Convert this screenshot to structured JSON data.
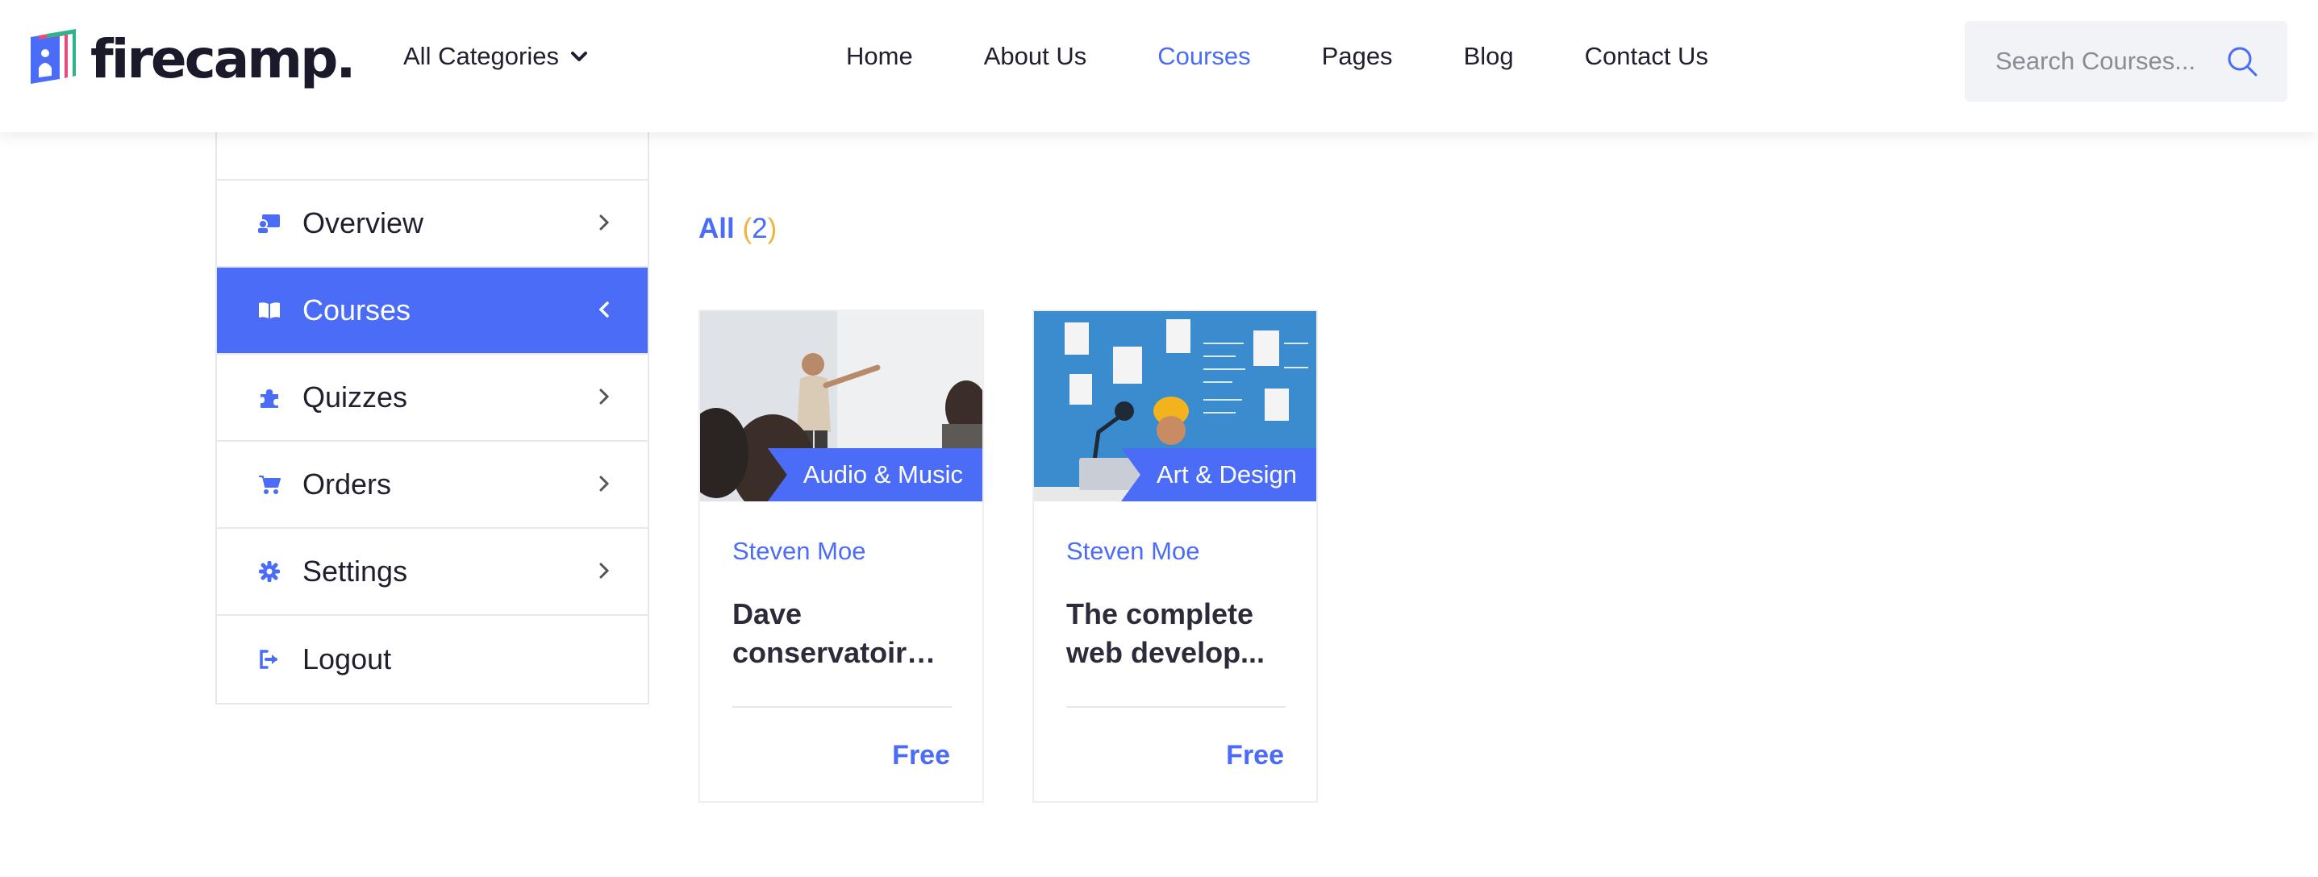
{
  "brand": {
    "name": "firecamp.",
    "accent": "#4a6cf7"
  },
  "header": {
    "categories_label": "All Categories",
    "nav": [
      {
        "label": "Home",
        "active": false
      },
      {
        "label": "About Us",
        "active": false
      },
      {
        "label": "Courses",
        "active": true
      },
      {
        "label": "Pages",
        "active": false
      },
      {
        "label": "Blog",
        "active": false
      },
      {
        "label": "Contact Us",
        "active": false
      }
    ],
    "search_placeholder": "Search Courses..."
  },
  "sidebar": {
    "items": [
      {
        "label": "Overview",
        "icon": "overview-icon",
        "active": false
      },
      {
        "label": "Courses",
        "icon": "book-icon",
        "active": true
      },
      {
        "label": "Quizzes",
        "icon": "puzzle-icon",
        "active": false
      },
      {
        "label": "Orders",
        "icon": "cart-icon",
        "active": false
      },
      {
        "label": "Settings",
        "icon": "gear-icon",
        "active": false
      },
      {
        "label": "Logout",
        "icon": "logout-icon",
        "active": false
      }
    ]
  },
  "filter": {
    "label": "All",
    "open": "(",
    "count": "2",
    "close": ")"
  },
  "courses": [
    {
      "category": "Audio & Music",
      "author": "Steven Moe",
      "title_line1": "Dave",
      "title_line2": "conservatoire i...",
      "price": "Free"
    },
    {
      "category": "Art & Design",
      "author": "Steven Moe",
      "title_line1": "The complete",
      "title_line2": "web develop...",
      "price": "Free"
    }
  ]
}
